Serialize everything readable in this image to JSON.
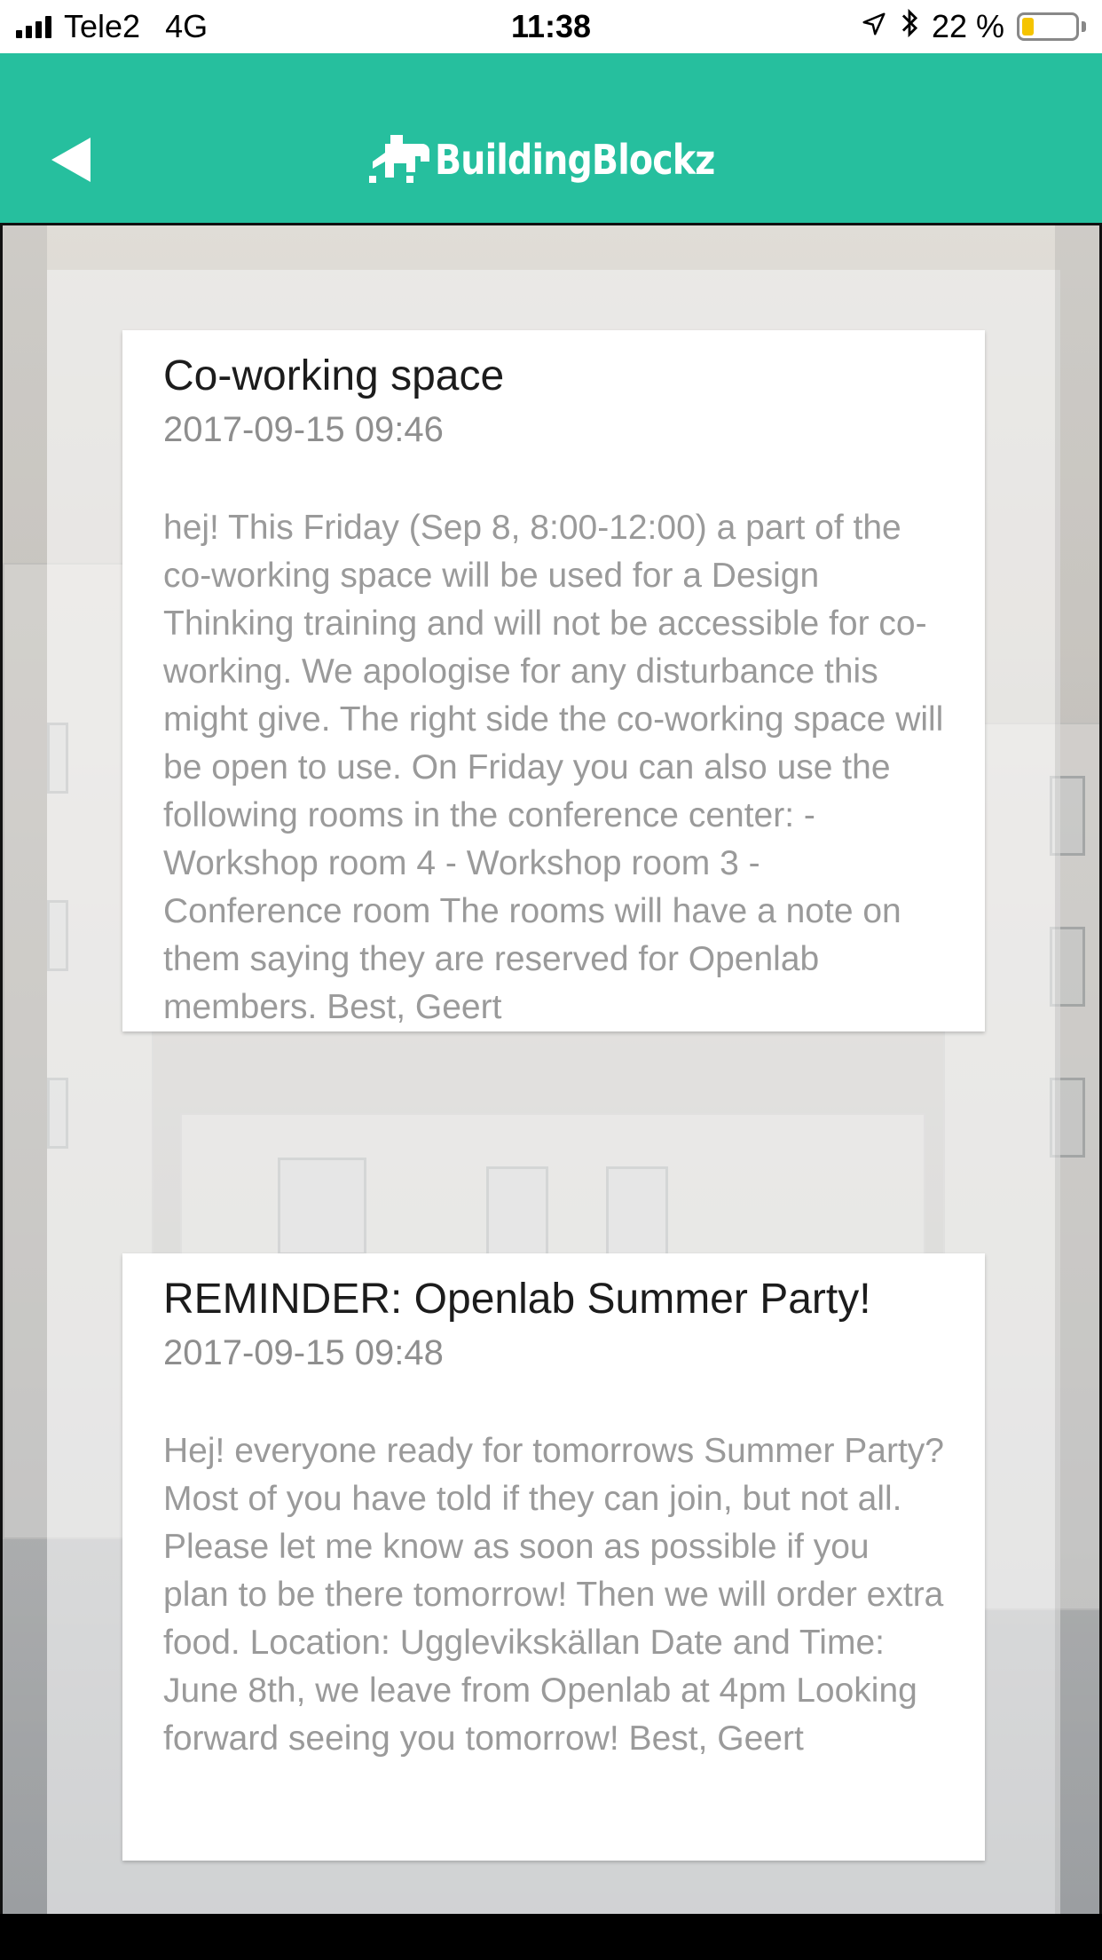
{
  "status_bar": {
    "carrier": "Tele2",
    "network": "4G",
    "time": "11:38",
    "battery_percent": "22 %",
    "battery_level": 0.22,
    "icons": [
      "signal-icon",
      "location-arrow-icon",
      "bluetooth-icon",
      "battery-icon"
    ]
  },
  "header": {
    "back_icon": "back-triangle-icon",
    "brand_name": "BuildingBlockz",
    "background_color": "#26bf9e"
  },
  "posts": [
    {
      "title": "Co-working space",
      "date": "2017-09-15 09:46",
      "body": "hej!  This Friday (Sep 8, 8:00-12:00) a part of the co-working space will be used for a Design Thinking training and will not be accessible for co-working. We apologise for any disturbance this might give. The right side the co-working space will be open to use.  On Friday you can also use the following rooms in the conference center: - Workshop room 4 - Workshop room 3 - Conference room The rooms will have a note on them saying they are reserved for Openlab members.  Best,  Geert"
    },
    {
      "title": "REMINDER: Openlab Summer Party!",
      "date": "2017-09-15 09:48",
      "body": "Hej!  everyone ready for tomorrows Summer Party?  Most of you have told if they can join, but not all. Please let me know as soon as possible if you plan to be there tomorrow!  Then we will order extra food.  Location: Ugglevikskällan Date and Time: June 8th, we leave from Openlab at 4pm  Looking forward seeing you tomorrow!  Best,  Geert"
    }
  ]
}
